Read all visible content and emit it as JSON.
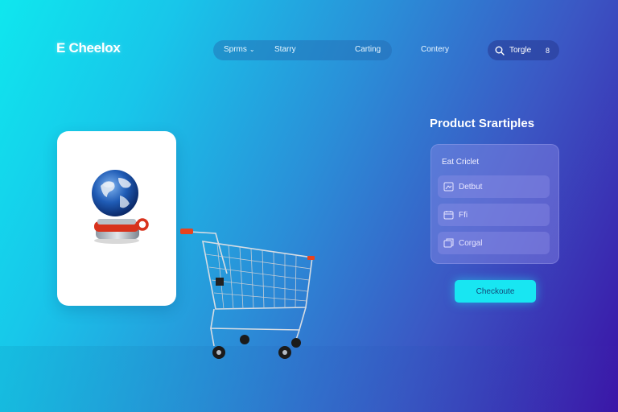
{
  "app": {
    "logo_text": "E Cheelox"
  },
  "nav": {
    "items": [
      {
        "label": "Sprms",
        "has_dropdown": true
      },
      {
        "label": "Starry"
      },
      {
        "label": "Carting"
      },
      {
        "label": "Contery"
      }
    ]
  },
  "search": {
    "label": "Torgle",
    "count": "8"
  },
  "product_panel": {
    "title": "Product Srartiples",
    "subtitle": "Eat Criclet",
    "options": [
      {
        "label": "Detbut",
        "icon": "image-icon"
      },
      {
        "label": "Ffi",
        "icon": "calendar-icon"
      },
      {
        "label": "Corgal",
        "icon": "gallery-icon"
      }
    ]
  },
  "checkout": {
    "label": "Checkoute"
  },
  "colors": {
    "accent": "#18e6f2",
    "gradient_start": "#0fe7ee",
    "gradient_end": "#3a12a6",
    "cart_handle": "#e8431e"
  }
}
